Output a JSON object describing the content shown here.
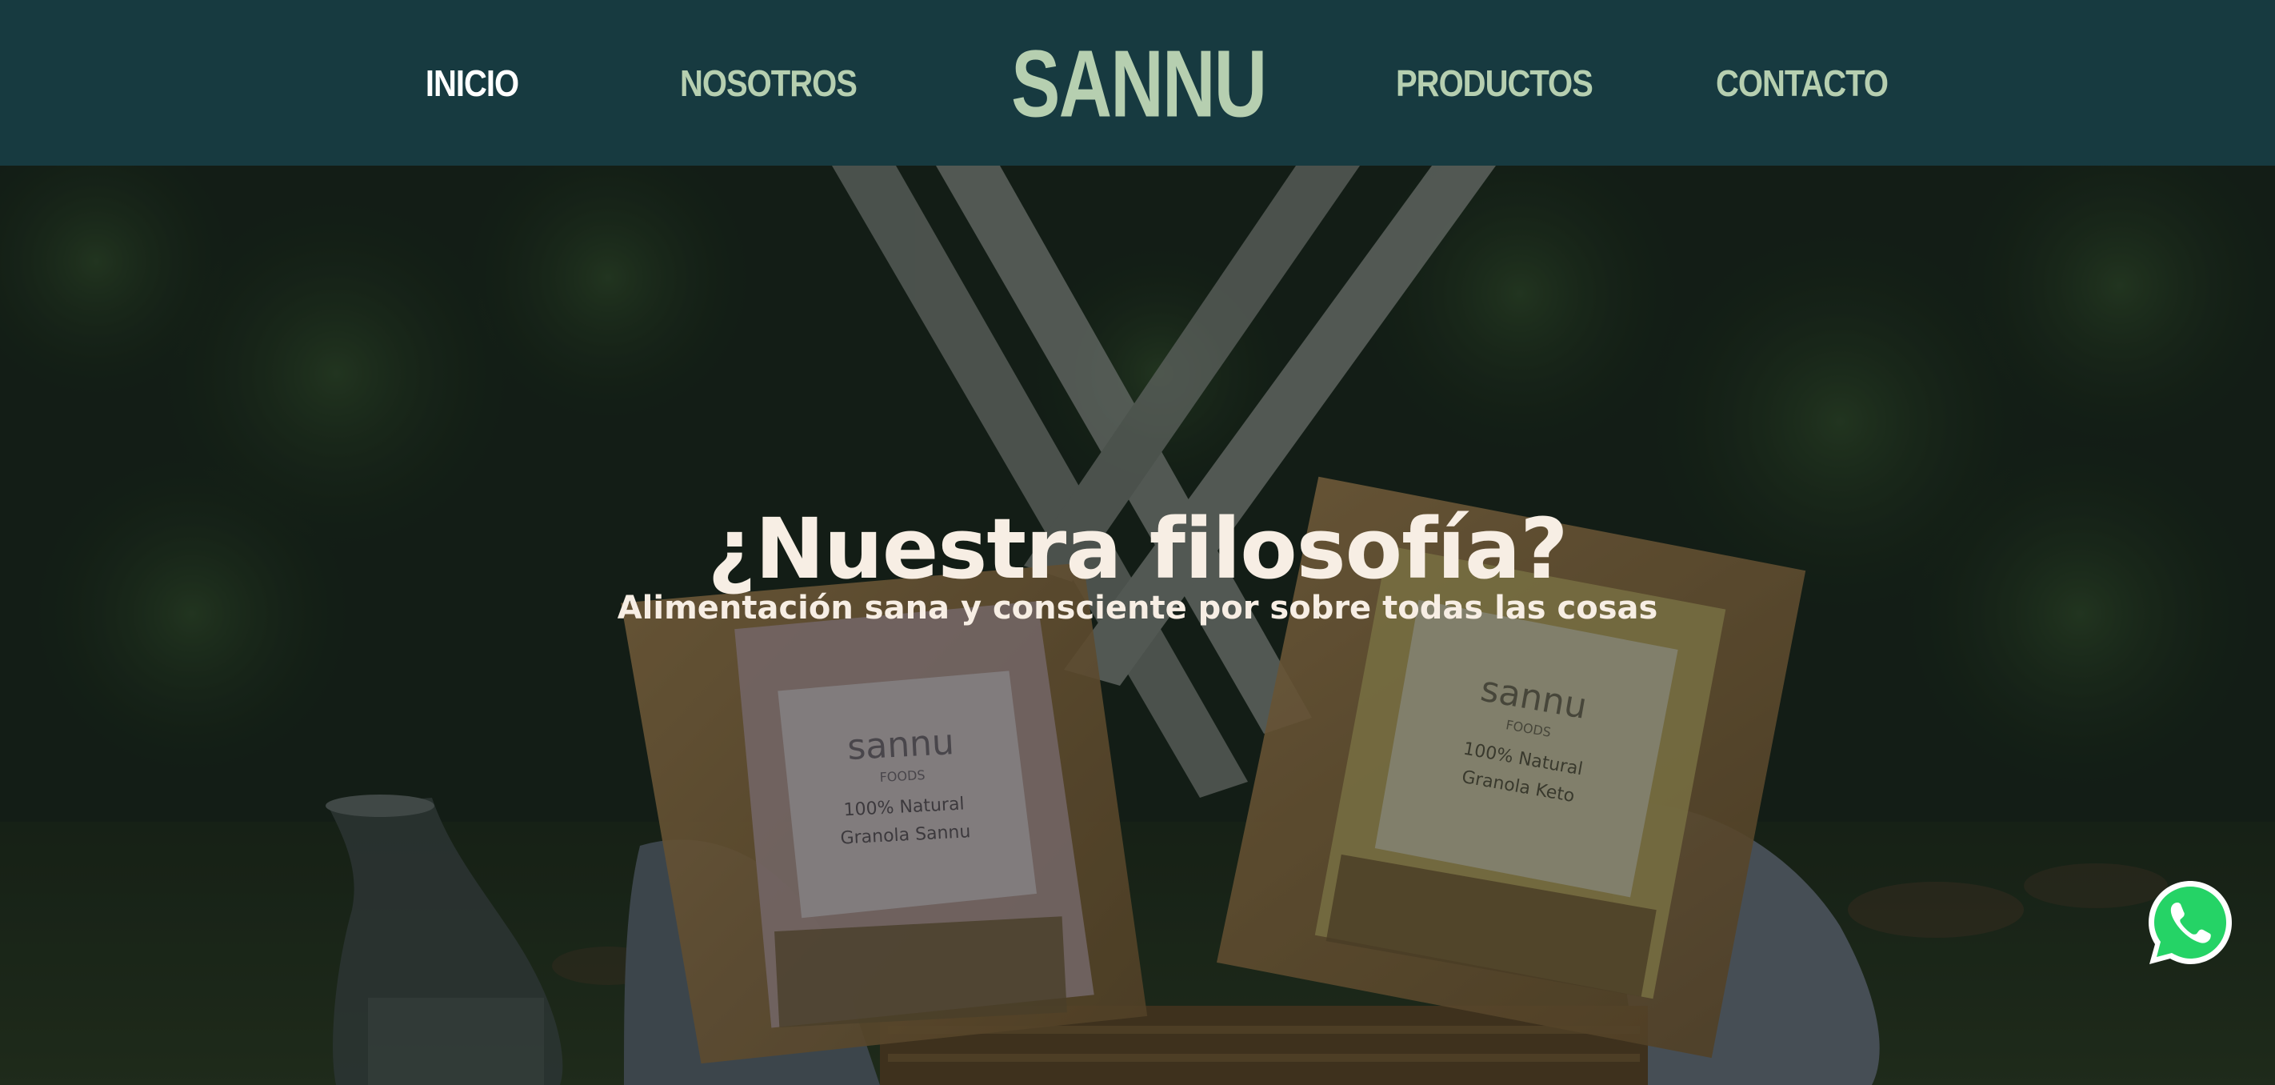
{
  "header": {
    "nav_left": [
      "INICIO",
      "NOSOTROS"
    ],
    "logo": "SANNU",
    "nav_right": [
      "PRODUCTOS",
      "CONTACTO"
    ],
    "active_item": "INICIO"
  },
  "hero": {
    "title": "¿Nuestra filosofía?",
    "subtitle": "Alimentación sana y consciente por sobre todas las cosas",
    "bag_left": {
      "brand": "sannu",
      "brand_sub": "FOODS",
      "tagline": "100% Natural",
      "product": "Granola Sannu"
    },
    "bag_right": {
      "brand": "sannu",
      "brand_sub": "FOODS",
      "tagline": "100% Natural",
      "product": "Granola Keto"
    }
  },
  "floating": {
    "whatsapp_icon": "whatsapp-icon"
  },
  "colors": {
    "header_bg": "#173a40",
    "nav_text": "#b6cfb0",
    "nav_active": "#ffffff",
    "hero_text": "#f7eee4",
    "whatsapp": "#25d366"
  }
}
